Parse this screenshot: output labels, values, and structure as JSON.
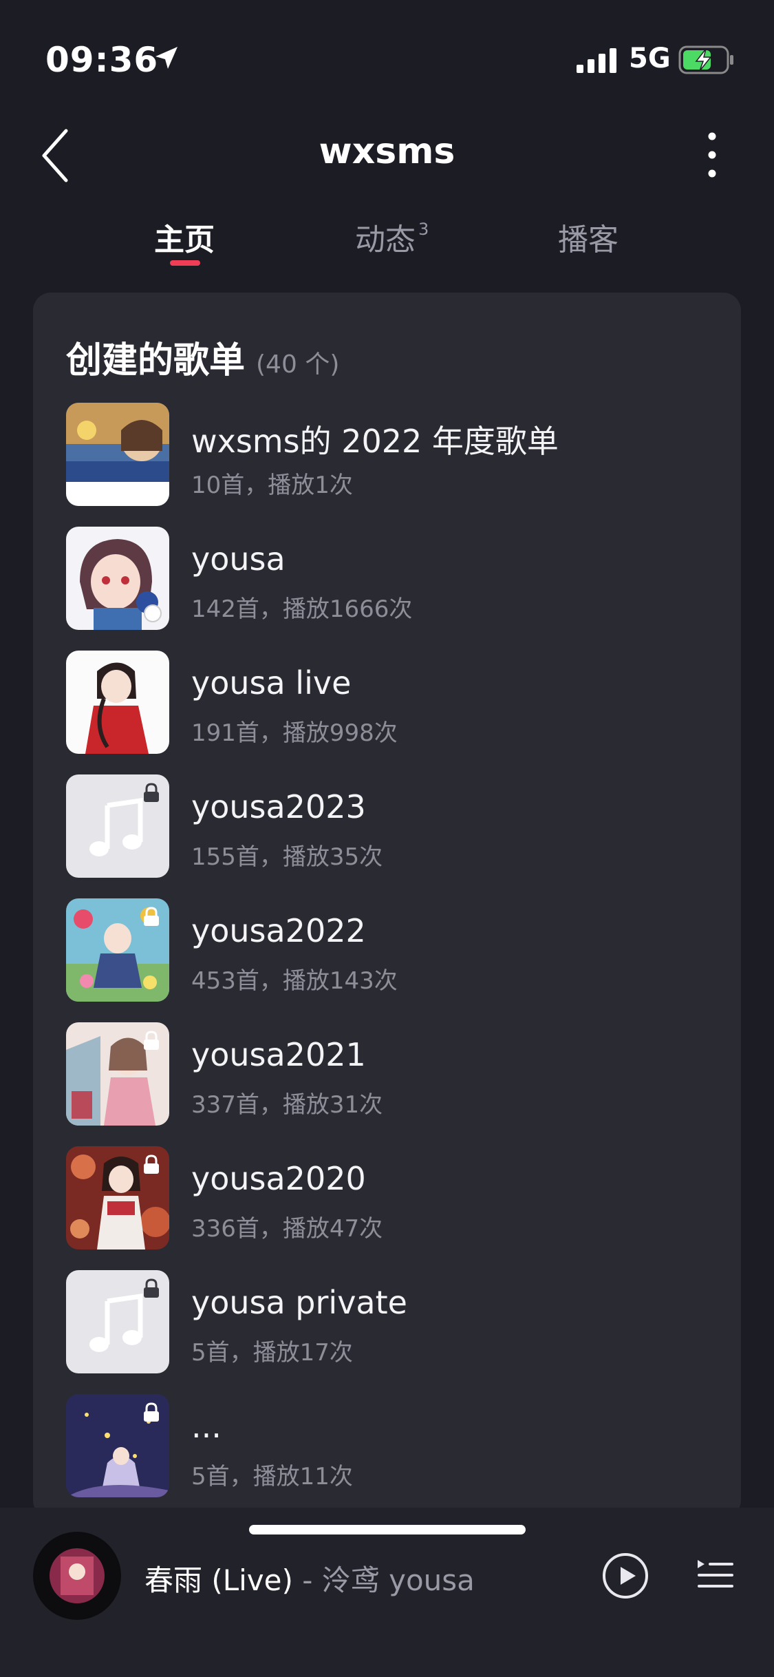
{
  "status_bar": {
    "time": "09:36",
    "network": "5G"
  },
  "header": {
    "title": "wxsms"
  },
  "tabs": [
    {
      "label": "主页",
      "badge": ""
    },
    {
      "label": "动态",
      "badge": "3"
    },
    {
      "label": "播客",
      "badge": ""
    }
  ],
  "section": {
    "title": "创建的歌单",
    "count": "(40 个)"
  },
  "playlists": [
    {
      "name": "wxsms的 2022 年度歌单",
      "meta": "10首，播放1次",
      "locked": false,
      "cover": "anime-art"
    },
    {
      "name": "yousa",
      "meta": "142首，播放1666次",
      "locked": false,
      "cover": "anime-art"
    },
    {
      "name": "yousa live",
      "meta": "191首，播放998次",
      "locked": false,
      "cover": "anime-art"
    },
    {
      "name": "yousa2023",
      "meta": "155首，播放35次",
      "locked": true,
      "cover": "music-note"
    },
    {
      "name": "yousa2022",
      "meta": "453首，播放143次",
      "locked": true,
      "cover": "anime-art"
    },
    {
      "name": "yousa2021",
      "meta": "337首，播放31次",
      "locked": true,
      "cover": "anime-art"
    },
    {
      "name": "yousa2020",
      "meta": "336首，播放47次",
      "locked": true,
      "cover": "anime-art"
    },
    {
      "name": "yousa private",
      "meta": "5首，播放17次",
      "locked": true,
      "cover": "music-note"
    },
    {
      "name": "...",
      "meta": "5首，播放11次",
      "locked": true,
      "cover": "anime-art"
    }
  ],
  "now_playing": {
    "title": "春雨 (Live)",
    "separator": " - ",
    "artist": "泠鸢 yousa"
  },
  "colors": {
    "background": "#1c1c24",
    "card": "#2a2a32",
    "accent": "#ef3e55",
    "battery": "#4cd964"
  }
}
